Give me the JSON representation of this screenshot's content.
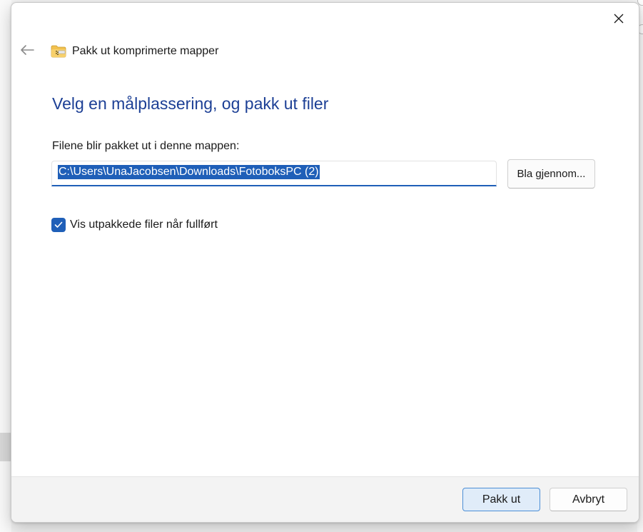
{
  "window": {
    "title": "Pakk ut komprimerte mapper",
    "close_icon": "close-icon",
    "back_icon": "arrow-left-icon",
    "folder_icon": "zip-folder-icon"
  },
  "main": {
    "heading": "Velg en målplassering, og pakk ut filer",
    "path_label": "Filene blir pakket ut i denne mappen:",
    "path_value": "C:\\Users\\UnaJacobsen\\Downloads\\FotoboksPC (2)",
    "browse_label": "Bla gjennom...",
    "checkbox_label": "Vis utpakkede filer når fullført",
    "checkbox_checked": true
  },
  "footer": {
    "extract_label": "Pakk ut",
    "cancel_label": "Avbryt"
  },
  "colors": {
    "accent": "#1f5fb8",
    "heading": "#1c3f95"
  }
}
